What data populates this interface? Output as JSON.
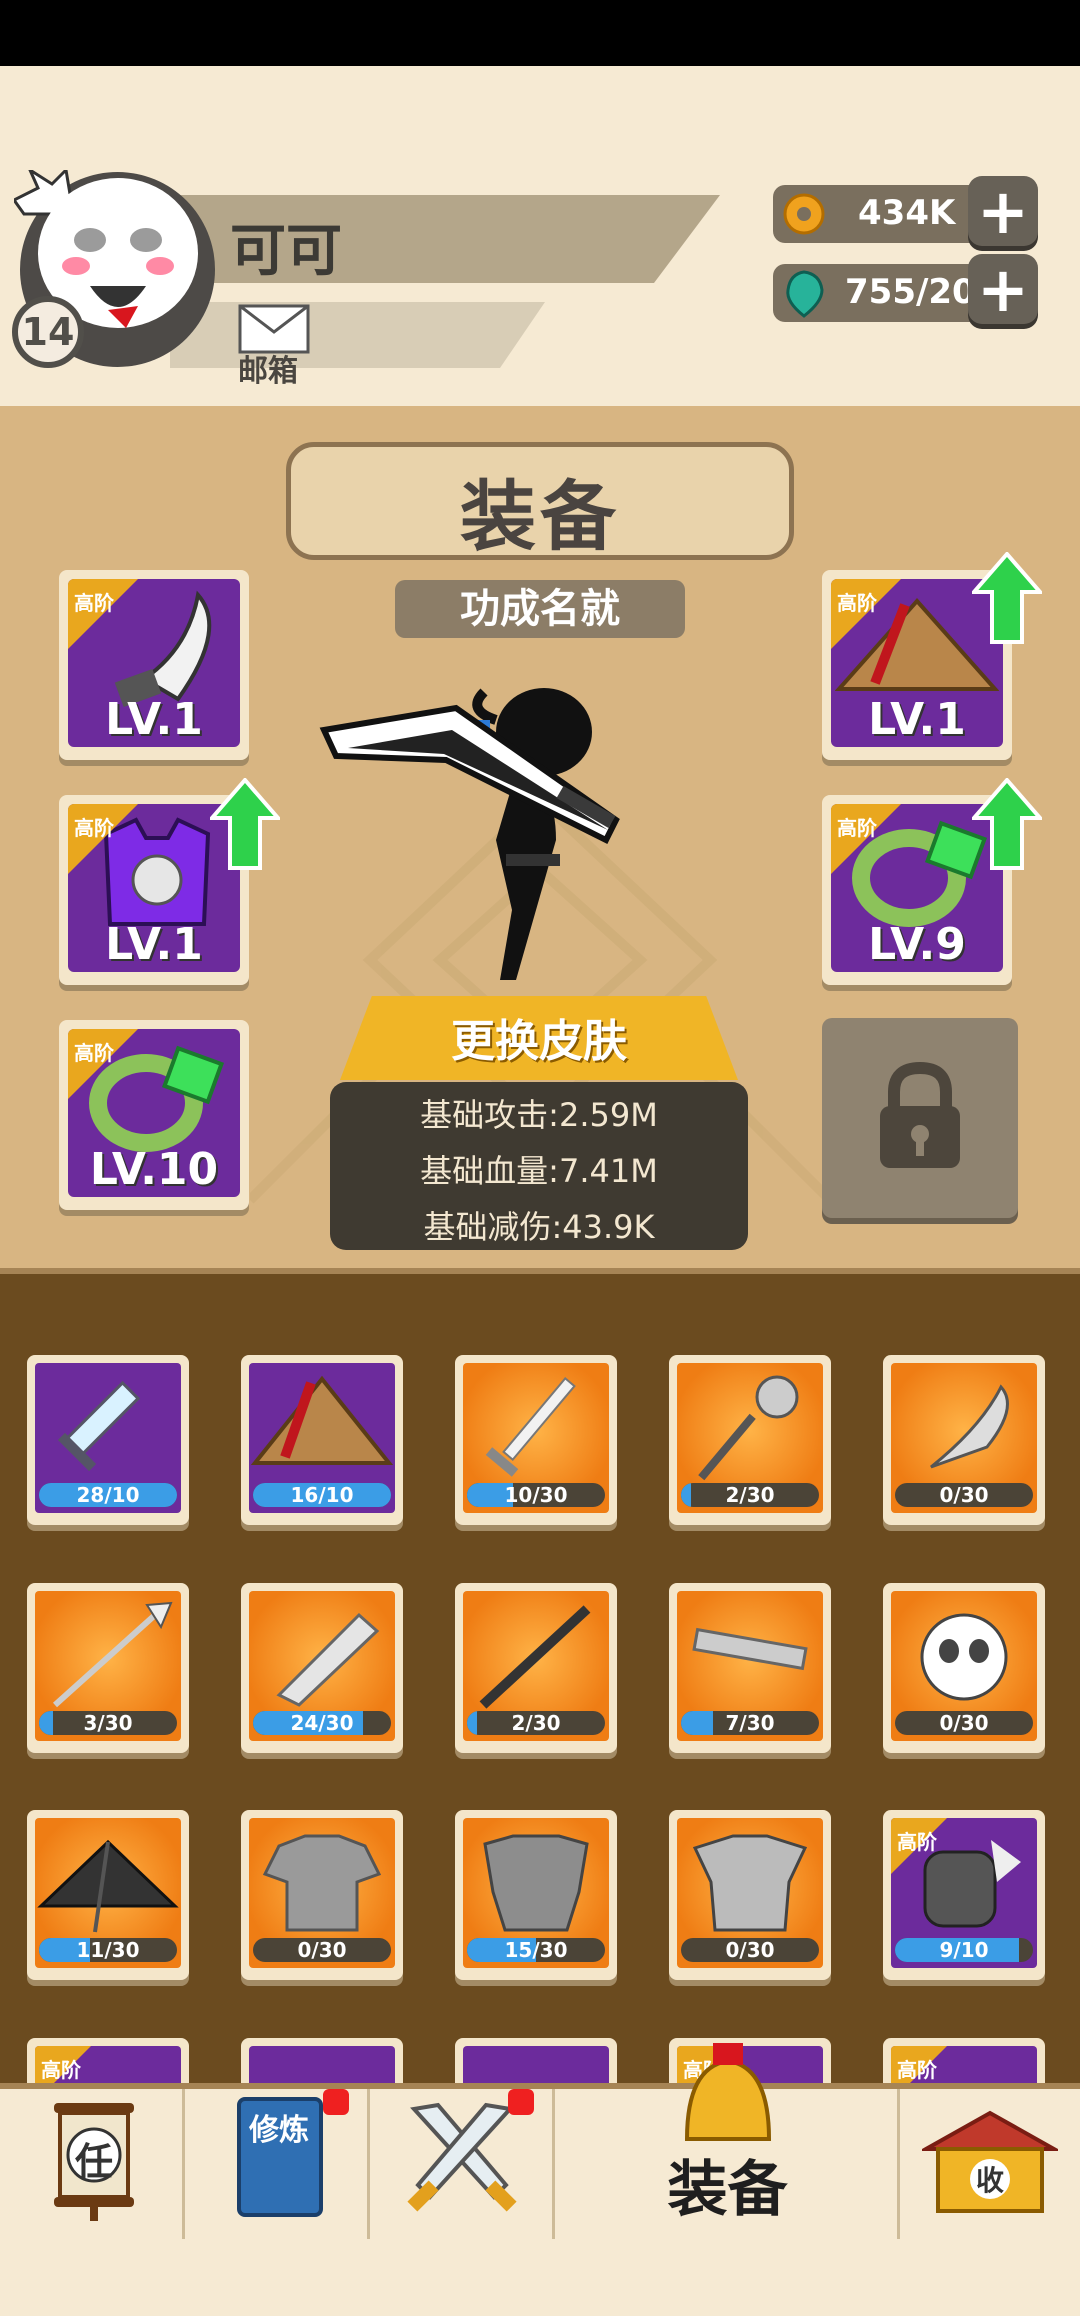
{
  "player": {
    "name": "可可",
    "level": "14",
    "mail_label": "邮箱"
  },
  "resources": {
    "gold": "434K",
    "gems": "755/20"
  },
  "equip": {
    "title": "装备",
    "subtitle": "功成名就",
    "skin_button": "更换皮肤",
    "stats": [
      "基础攻击:2.59M",
      "基础血量:7.41M",
      "基础减伤:43.9K"
    ],
    "slots": [
      {
        "tier": "高阶",
        "level": "LV.1",
        "icon": "cleaver-icon",
        "upgrade": false
      },
      {
        "tier": "高阶",
        "level": "LV.1",
        "icon": "armor-vest-icon",
        "upgrade": true
      },
      {
        "tier": "高阶",
        "level": "LV.10",
        "icon": "bracelet-icon",
        "upgrade": false
      },
      {
        "tier": "高阶",
        "level": "LV.1",
        "icon": "straw-hat-icon",
        "upgrade": true
      },
      {
        "tier": "高阶",
        "level": "LV.9",
        "icon": "bracelet-icon",
        "upgrade": true
      }
    ]
  },
  "inventory": [
    {
      "progress": "28/10",
      "fill": 1.0,
      "bg": "purple",
      "icon": "pixel-sword-icon"
    },
    {
      "progress": "16/10",
      "fill": 1.0,
      "bg": "purple",
      "icon": "straw-hat-icon"
    },
    {
      "progress": "10/30",
      "fill": 0.33,
      "bg": "orange",
      "icon": "sword-icon"
    },
    {
      "progress": "2/30",
      "fill": 0.07,
      "bg": "orange",
      "icon": "mace-icon"
    },
    {
      "progress": "0/30",
      "fill": 0.0,
      "bg": "orange",
      "icon": "drumstick-icon"
    },
    {
      "progress": "3/30",
      "fill": 0.1,
      "bg": "orange",
      "icon": "spear-icon"
    },
    {
      "progress": "24/30",
      "fill": 0.8,
      "bg": "orange",
      "icon": "broadsword-icon"
    },
    {
      "progress": "2/30",
      "fill": 0.07,
      "bg": "orange",
      "icon": "staff-icon"
    },
    {
      "progress": "7/30",
      "fill": 0.23,
      "bg": "orange",
      "icon": "key-blade-icon"
    },
    {
      "progress": "0/30",
      "fill": 0.0,
      "bg": "orange",
      "icon": "bird-mask-icon"
    },
    {
      "progress": "11/30",
      "fill": 0.37,
      "bg": "orange",
      "icon": "bamboo-hat-icon"
    },
    {
      "progress": "0/30",
      "fill": 0.0,
      "bg": "tshirt",
      "icon": "tshirt-icon"
    },
    {
      "progress": "15/30",
      "fill": 0.5,
      "bg": "orange",
      "icon": "plate-armor-icon"
    },
    {
      "progress": "0/30",
      "fill": 0.0,
      "bg": "orange",
      "icon": "robe-armor-icon"
    },
    {
      "progress": "9/10",
      "fill": 0.9,
      "bg": "purple",
      "icon": "spiked-gauntlet-icon",
      "tier": "高阶"
    }
  ],
  "partial_row_tiers": [
    "高阶",
    "",
    "",
    "高阶",
    "高阶"
  ],
  "tabs": {
    "task": "任",
    "train": "修炼",
    "collect": "收",
    "equip_label": "装备"
  },
  "colors": {
    "accent": "#f0b526",
    "purple": "#6c2b9c",
    "progress": "#3b9de6",
    "panel": "#d8b582",
    "inventory": "#6b4b1f"
  }
}
